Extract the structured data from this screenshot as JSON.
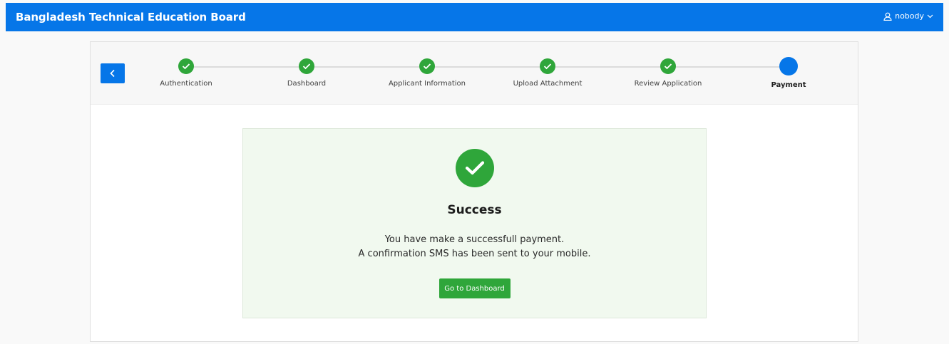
{
  "header": {
    "title": "Bangladesh Technical Education Board",
    "user_name": "nobody",
    "icons": {
      "user": "user-icon",
      "dropdown": "chevron-down-icon"
    }
  },
  "wizard": {
    "back_icon": "chevron-left-icon",
    "steps": [
      {
        "label": "Authentication",
        "status": "complete"
      },
      {
        "label": "Dashboard",
        "status": "complete"
      },
      {
        "label": "Applicant Information",
        "status": "complete"
      },
      {
        "label": "Upload Attachment",
        "status": "complete"
      },
      {
        "label": "Review Application",
        "status": "complete"
      },
      {
        "label": "Payment",
        "status": "current"
      }
    ]
  },
  "success": {
    "icon": "check-circle-icon",
    "title": "Success",
    "message_line1": "You have make a successfull payment.",
    "message_line2": "A confirmation SMS has been sent to your mobile.",
    "button_label": "Go to Dashboard"
  },
  "colors": {
    "primary": "#0676e8",
    "success": "#2fa63a",
    "panel_bg": "#f1f9ef"
  }
}
